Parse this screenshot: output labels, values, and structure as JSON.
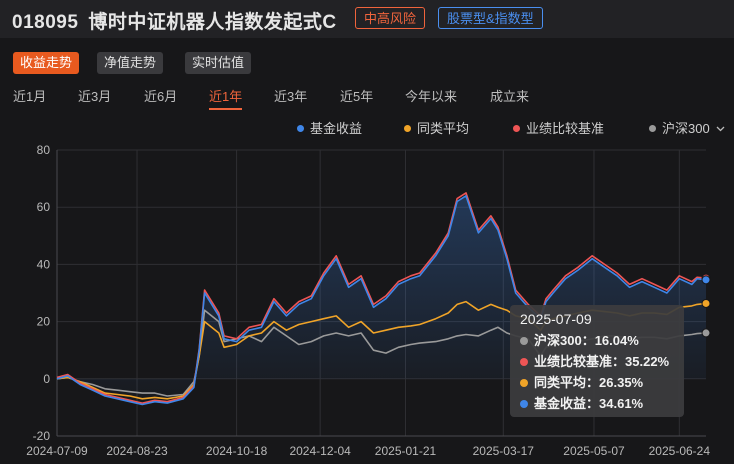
{
  "fund": {
    "code": "018095",
    "name": "博时中证机器人指数发起式C"
  },
  "tags": {
    "risk": "中高风险",
    "type": "股票型&指数型"
  },
  "view_buttons": [
    {
      "label": "收益走势",
      "active": true
    },
    {
      "label": "净值走势",
      "active": false
    },
    {
      "label": "实时估值",
      "active": false
    }
  ],
  "periods": [
    {
      "label": "近1月",
      "active": false
    },
    {
      "label": "近3月",
      "active": false
    },
    {
      "label": "近6月",
      "active": false
    },
    {
      "label": "近1年",
      "active": true
    },
    {
      "label": "近3年",
      "active": false
    },
    {
      "label": "近5年",
      "active": false
    },
    {
      "label": "今年以来",
      "active": false
    },
    {
      "label": "成立来",
      "active": false
    }
  ],
  "legend_dropdown_icon": "chevron-down-icon",
  "colors": {
    "fund": "#3f86e8",
    "peer": "#f0a428",
    "benchmark": "#ee5555",
    "csi300": "#9a9a9a",
    "accent": "#e85a1f"
  },
  "tooltip": {
    "date": "2025-07-09",
    "rows": [
      {
        "label": "沪深300：",
        "value": "16.04%",
        "series": "csi300"
      },
      {
        "label": "业绩比较基准：",
        "value": "35.22%",
        "series": "benchmark"
      },
      {
        "label": "同类平均：",
        "value": "26.35%",
        "series": "peer"
      },
      {
        "label": "基金收益：",
        "value": "34.61%",
        "series": "fund"
      }
    ]
  },
  "chart_data": {
    "type": "line",
    "ylim": [
      -20,
      80
    ],
    "yticks": [
      -20,
      0,
      20,
      40,
      60,
      80
    ],
    "xticks": [
      "2024-07-09",
      "2024-08-23",
      "2024-10-18",
      "2024-12-04",
      "2025-01-21",
      "2025-03-17",
      "2025-05-07",
      "2025-06-24"
    ],
    "grid": true,
    "legend_position": "top-right",
    "series": [
      {
        "name": "基金收益",
        "key": "fund",
        "area": true,
        "points": [
          [
            "2024-07-09",
            0
          ],
          [
            "2024-07-15",
            1
          ],
          [
            "2024-07-22",
            -2
          ],
          [
            "2024-07-29",
            -4
          ],
          [
            "2024-08-05",
            -6
          ],
          [
            "2024-08-12",
            -7
          ],
          [
            "2024-08-19",
            -8
          ],
          [
            "2024-08-26",
            -9
          ],
          [
            "2024-09-02",
            -8
          ],
          [
            "2024-09-09",
            -8.5
          ],
          [
            "2024-09-18",
            -7
          ],
          [
            "2024-09-24",
            -3
          ],
          [
            "2024-09-27",
            10
          ],
          [
            "2024-09-30",
            30
          ],
          [
            "2024-10-08",
            22
          ],
          [
            "2024-10-11",
            14
          ],
          [
            "2024-10-18",
            13
          ],
          [
            "2024-10-25",
            17
          ],
          [
            "2024-11-01",
            18
          ],
          [
            "2024-11-08",
            27
          ],
          [
            "2024-11-15",
            22
          ],
          [
            "2024-11-22",
            26
          ],
          [
            "2024-11-29",
            28
          ],
          [
            "2024-12-06",
            36
          ],
          [
            "2024-12-13",
            42
          ],
          [
            "2024-12-20",
            32
          ],
          [
            "2024-12-27",
            35
          ],
          [
            "2025-01-03",
            25
          ],
          [
            "2025-01-10",
            28
          ],
          [
            "2025-01-17",
            33
          ],
          [
            "2025-01-24",
            35
          ],
          [
            "2025-01-29",
            36
          ],
          [
            "2025-02-07",
            43
          ],
          [
            "2025-02-14",
            50
          ],
          [
            "2025-02-19",
            62
          ],
          [
            "2025-02-24",
            64
          ],
          [
            "2025-03-03",
            51
          ],
          [
            "2025-03-10",
            56
          ],
          [
            "2025-03-14",
            52
          ],
          [
            "2025-03-19",
            42
          ],
          [
            "2025-03-24",
            30
          ],
          [
            "2025-03-31",
            25
          ],
          [
            "2025-04-07",
            21
          ],
          [
            "2025-04-10",
            27
          ],
          [
            "2025-04-14",
            30
          ],
          [
            "2025-04-21",
            35
          ],
          [
            "2025-04-28",
            38
          ],
          [
            "2025-05-06",
            42
          ],
          [
            "2025-05-13",
            39
          ],
          [
            "2025-05-20",
            36
          ],
          [
            "2025-05-27",
            32
          ],
          [
            "2025-06-03",
            34
          ],
          [
            "2025-06-10",
            32
          ],
          [
            "2025-06-17",
            30
          ],
          [
            "2025-06-24",
            35
          ],
          [
            "2025-07-01",
            33
          ],
          [
            "2025-07-04",
            35
          ],
          [
            "2025-07-09",
            34.61
          ]
        ]
      },
      {
        "name": "同类平均",
        "key": "peer",
        "area": false,
        "points": [
          [
            "2024-07-09",
            0
          ],
          [
            "2024-07-15",
            0.5
          ],
          [
            "2024-07-22",
            -1
          ],
          [
            "2024-07-29",
            -3
          ],
          [
            "2024-08-05",
            -5
          ],
          [
            "2024-08-12",
            -5.5
          ],
          [
            "2024-08-19",
            -6
          ],
          [
            "2024-08-26",
            -7
          ],
          [
            "2024-09-02",
            -6.5
          ],
          [
            "2024-09-09",
            -7
          ],
          [
            "2024-09-18",
            -6
          ],
          [
            "2024-09-24",
            -2
          ],
          [
            "2024-09-27",
            8
          ],
          [
            "2024-09-30",
            20
          ],
          [
            "2024-10-08",
            16
          ],
          [
            "2024-10-11",
            11
          ],
          [
            "2024-10-18",
            12
          ],
          [
            "2024-10-25",
            15
          ],
          [
            "2024-11-01",
            16
          ],
          [
            "2024-11-08",
            20
          ],
          [
            "2024-11-15",
            17
          ],
          [
            "2024-11-22",
            19
          ],
          [
            "2024-11-29",
            20
          ],
          [
            "2024-12-06",
            21
          ],
          [
            "2024-12-13",
            22
          ],
          [
            "2024-12-20",
            18
          ],
          [
            "2024-12-27",
            20
          ],
          [
            "2025-01-03",
            16
          ],
          [
            "2025-01-10",
            17
          ],
          [
            "2025-01-17",
            18
          ],
          [
            "2025-01-24",
            18.5
          ],
          [
            "2025-01-29",
            19
          ],
          [
            "2025-02-07",
            21
          ],
          [
            "2025-02-14",
            23
          ],
          [
            "2025-02-19",
            26
          ],
          [
            "2025-02-24",
            27
          ],
          [
            "2025-03-03",
            24
          ],
          [
            "2025-03-10",
            26
          ],
          [
            "2025-03-14",
            25
          ],
          [
            "2025-03-19",
            24
          ],
          [
            "2025-03-24",
            22
          ],
          [
            "2025-03-31",
            21
          ],
          [
            "2025-04-07",
            17
          ],
          [
            "2025-04-10",
            20
          ],
          [
            "2025-04-14",
            21
          ],
          [
            "2025-04-21",
            22
          ],
          [
            "2025-04-28",
            23
          ],
          [
            "2025-05-06",
            24
          ],
          [
            "2025-05-13",
            23.5
          ],
          [
            "2025-05-20",
            23
          ],
          [
            "2025-05-27",
            22
          ],
          [
            "2025-06-03",
            23
          ],
          [
            "2025-06-10",
            23
          ],
          [
            "2025-06-17",
            22.5
          ],
          [
            "2025-06-24",
            25
          ],
          [
            "2025-07-01",
            25.5
          ],
          [
            "2025-07-04",
            26
          ],
          [
            "2025-07-09",
            26.35
          ]
        ]
      },
      {
        "name": "业绩比较基准",
        "key": "benchmark",
        "area": false,
        "points": [
          [
            "2024-07-09",
            0.5
          ],
          [
            "2024-07-15",
            1.5
          ],
          [
            "2024-07-22",
            -1.5
          ],
          [
            "2024-07-29",
            -3.5
          ],
          [
            "2024-08-05",
            -5.5
          ],
          [
            "2024-08-12",
            -6.5
          ],
          [
            "2024-08-19",
            -7.5
          ],
          [
            "2024-08-26",
            -8.5
          ],
          [
            "2024-09-02",
            -7.5
          ],
          [
            "2024-09-09",
            -8
          ],
          [
            "2024-09-18",
            -6.5
          ],
          [
            "2024-09-24",
            -2.5
          ],
          [
            "2024-09-27",
            10.5
          ],
          [
            "2024-09-30",
            31
          ],
          [
            "2024-10-08",
            23
          ],
          [
            "2024-10-11",
            15
          ],
          [
            "2024-10-18",
            14
          ],
          [
            "2024-10-25",
            18
          ],
          [
            "2024-11-01",
            19
          ],
          [
            "2024-11-08",
            28
          ],
          [
            "2024-11-15",
            23
          ],
          [
            "2024-11-22",
            27
          ],
          [
            "2024-11-29",
            29
          ],
          [
            "2024-12-06",
            37
          ],
          [
            "2024-12-13",
            43
          ],
          [
            "2024-12-20",
            33
          ],
          [
            "2024-12-27",
            36
          ],
          [
            "2025-01-03",
            26
          ],
          [
            "2025-01-10",
            29
          ],
          [
            "2025-01-17",
            34
          ],
          [
            "2025-01-24",
            36
          ],
          [
            "2025-01-29",
            37
          ],
          [
            "2025-02-07",
            44
          ],
          [
            "2025-02-14",
            51
          ],
          [
            "2025-02-19",
            63
          ],
          [
            "2025-02-24",
            65
          ],
          [
            "2025-03-03",
            52
          ],
          [
            "2025-03-10",
            57
          ],
          [
            "2025-03-14",
            53
          ],
          [
            "2025-03-19",
            43
          ],
          [
            "2025-03-24",
            31
          ],
          [
            "2025-03-31",
            26
          ],
          [
            "2025-04-07",
            22
          ],
          [
            "2025-04-10",
            28
          ],
          [
            "2025-04-14",
            31
          ],
          [
            "2025-04-21",
            36
          ],
          [
            "2025-04-28",
            39
          ],
          [
            "2025-05-06",
            43
          ],
          [
            "2025-05-13",
            40
          ],
          [
            "2025-05-20",
            37
          ],
          [
            "2025-05-27",
            33
          ],
          [
            "2025-06-03",
            35
          ],
          [
            "2025-06-10",
            33
          ],
          [
            "2025-06-17",
            31
          ],
          [
            "2025-06-24",
            36
          ],
          [
            "2025-07-01",
            34
          ],
          [
            "2025-07-04",
            35.5
          ],
          [
            "2025-07-09",
            35.22
          ]
        ]
      },
      {
        "name": "沪深300",
        "key": "csi300",
        "area": false,
        "points": [
          [
            "2024-07-09",
            0
          ],
          [
            "2024-07-15",
            0.5
          ],
          [
            "2024-07-22",
            -1
          ],
          [
            "2024-07-29",
            -2
          ],
          [
            "2024-08-05",
            -3.5
          ],
          [
            "2024-08-12",
            -4
          ],
          [
            "2024-08-19",
            -4.5
          ],
          [
            "2024-08-26",
            -5
          ],
          [
            "2024-09-02",
            -5
          ],
          [
            "2024-09-09",
            -6
          ],
          [
            "2024-09-18",
            -5.5
          ],
          [
            "2024-09-24",
            -1
          ],
          [
            "2024-09-27",
            8
          ],
          [
            "2024-09-30",
            24
          ],
          [
            "2024-10-08",
            20
          ],
          [
            "2024-10-11",
            13
          ],
          [
            "2024-10-18",
            14
          ],
          [
            "2024-10-25",
            15
          ],
          [
            "2024-11-01",
            13
          ],
          [
            "2024-11-08",
            18
          ],
          [
            "2024-11-15",
            15
          ],
          [
            "2024-11-22",
            12
          ],
          [
            "2024-11-29",
            13
          ],
          [
            "2024-12-06",
            15
          ],
          [
            "2024-12-13",
            16
          ],
          [
            "2024-12-20",
            15
          ],
          [
            "2024-12-27",
            16
          ],
          [
            "2025-01-03",
            10
          ],
          [
            "2025-01-10",
            9
          ],
          [
            "2025-01-17",
            11
          ],
          [
            "2025-01-24",
            12
          ],
          [
            "2025-01-29",
            12.5
          ],
          [
            "2025-02-07",
            13
          ],
          [
            "2025-02-14",
            14
          ],
          [
            "2025-02-19",
            15
          ],
          [
            "2025-02-24",
            15.5
          ],
          [
            "2025-03-03",
            15
          ],
          [
            "2025-03-10",
            17
          ],
          [
            "2025-03-14",
            18
          ],
          [
            "2025-03-19",
            16
          ],
          [
            "2025-03-24",
            15
          ],
          [
            "2025-03-31",
            14
          ],
          [
            "2025-04-07",
            8
          ],
          [
            "2025-04-10",
            11
          ],
          [
            "2025-04-14",
            12
          ],
          [
            "2025-04-21",
            12.5
          ],
          [
            "2025-04-28",
            13
          ],
          [
            "2025-05-06",
            14
          ],
          [
            "2025-05-13",
            15
          ],
          [
            "2025-05-20",
            15
          ],
          [
            "2025-05-27",
            14
          ],
          [
            "2025-06-03",
            14.5
          ],
          [
            "2025-06-10",
            14.5
          ],
          [
            "2025-06-17",
            14
          ],
          [
            "2025-06-24",
            15
          ],
          [
            "2025-07-01",
            15.5
          ],
          [
            "2025-07-04",
            15.8
          ],
          [
            "2025-07-09",
            16.04
          ]
        ]
      }
    ]
  }
}
